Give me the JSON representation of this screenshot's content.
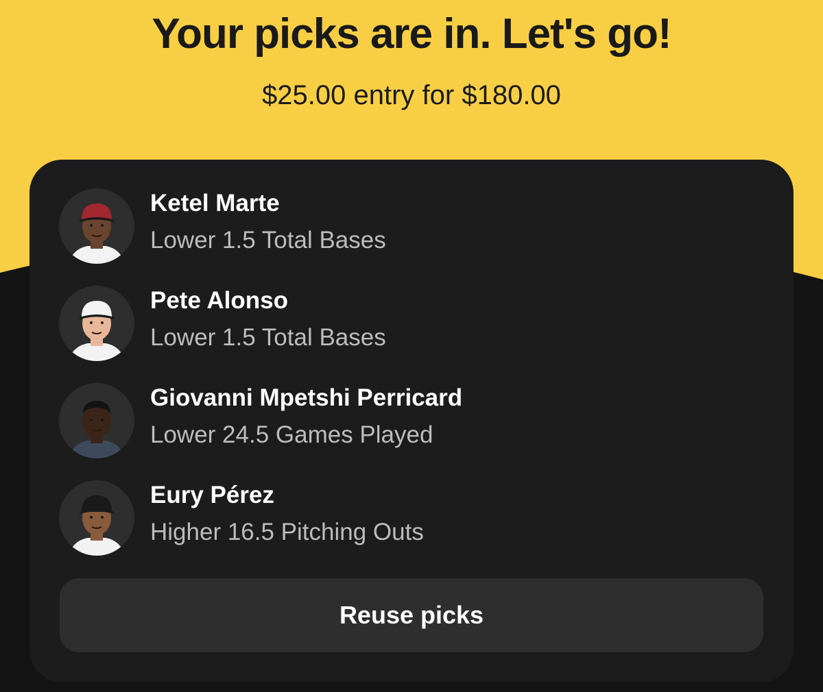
{
  "colors": {
    "header_background": "#f8cf44",
    "page_background": "#141414",
    "card_background": "#1c1c1c",
    "button_background": "#2e2e2e"
  },
  "header": {
    "title": "Your picks are in. Let's go!",
    "entry_text": "$25.00 entry for $180.00"
  },
  "picks": [
    {
      "player": "Ketel Marte",
      "pick": "Lower 1.5 Total Bases",
      "avatar_icon": "player-headshot-icon",
      "cap_color": "#a3272f",
      "jersey_color": "#f2f2f2",
      "skin_color": "#6b4430"
    },
    {
      "player": "Pete Alonso",
      "pick": "Lower 1.5 Total Bases",
      "avatar_icon": "player-headshot-icon",
      "cap_color": "#f4f4f4",
      "jersey_color": "#f2f2f2",
      "skin_color": "#e8b79a"
    },
    {
      "player": "Giovanni Mpetshi Perricard",
      "pick": "Lower 24.5 Games Played",
      "avatar_icon": "player-headshot-icon",
      "cap_color": "",
      "jersey_color": "#3c4a5c",
      "skin_color": "#3b2519"
    },
    {
      "player": "Eury Pérez",
      "pick": "Higher 16.5 Pitching Outs",
      "avatar_icon": "player-headshot-icon",
      "cap_color": "#1a1a1a",
      "jersey_color": "#f2f2f2",
      "skin_color": "#8a5a3c"
    }
  ],
  "actions": {
    "reuse_label": "Reuse picks"
  }
}
